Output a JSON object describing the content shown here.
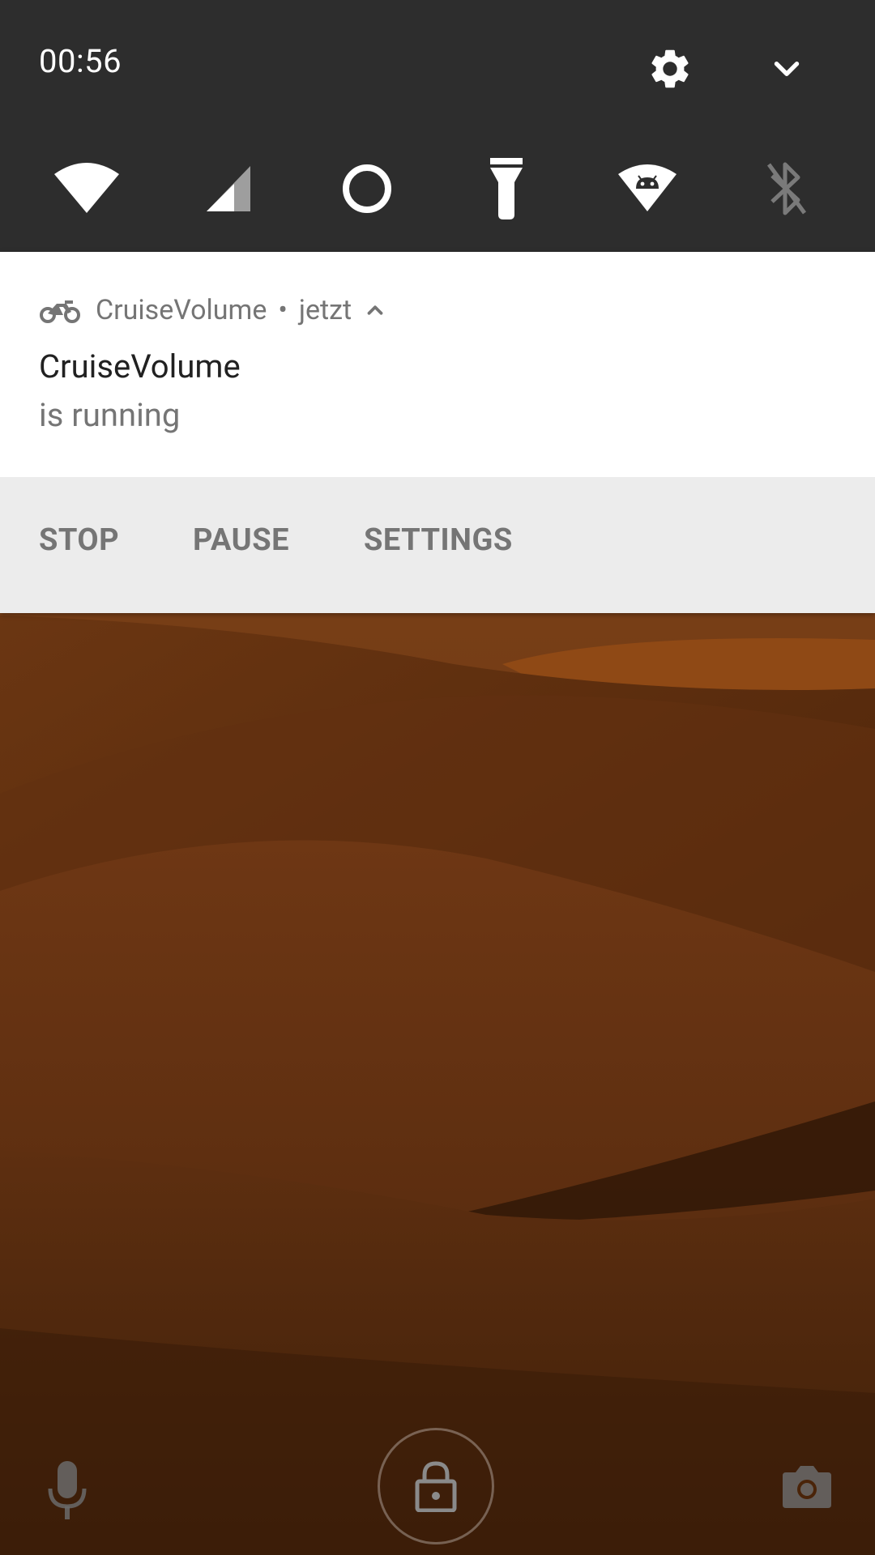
{
  "status_bar": {
    "time": "00:56"
  },
  "quick_settings": {
    "tiles": [
      {
        "name": "wifi",
        "icon": "wifi-icon"
      },
      {
        "name": "cellular",
        "icon": "cellular-signal-icon"
      },
      {
        "name": "data-saver",
        "icon": "data-saver-icon"
      },
      {
        "name": "flashlight",
        "icon": "flashlight-icon"
      },
      {
        "name": "hotspot",
        "icon": "hotspot-icon"
      },
      {
        "name": "bluetooth",
        "icon": "bluetooth-disabled-icon"
      }
    ]
  },
  "notification": {
    "app_name": "CruiseVolume",
    "separator": "•",
    "time": "jetzt",
    "title": "CruiseVolume",
    "text": "is running",
    "actions": [
      {
        "label": "STOP"
      },
      {
        "label": "PAUSE"
      },
      {
        "label": "SETTINGS"
      }
    ]
  },
  "colors": {
    "header_bg": "#2d2d2d",
    "card_bg": "#ffffff",
    "actions_bg": "#ececec",
    "secondary_text": "#757575",
    "primary_text": "#212121"
  }
}
